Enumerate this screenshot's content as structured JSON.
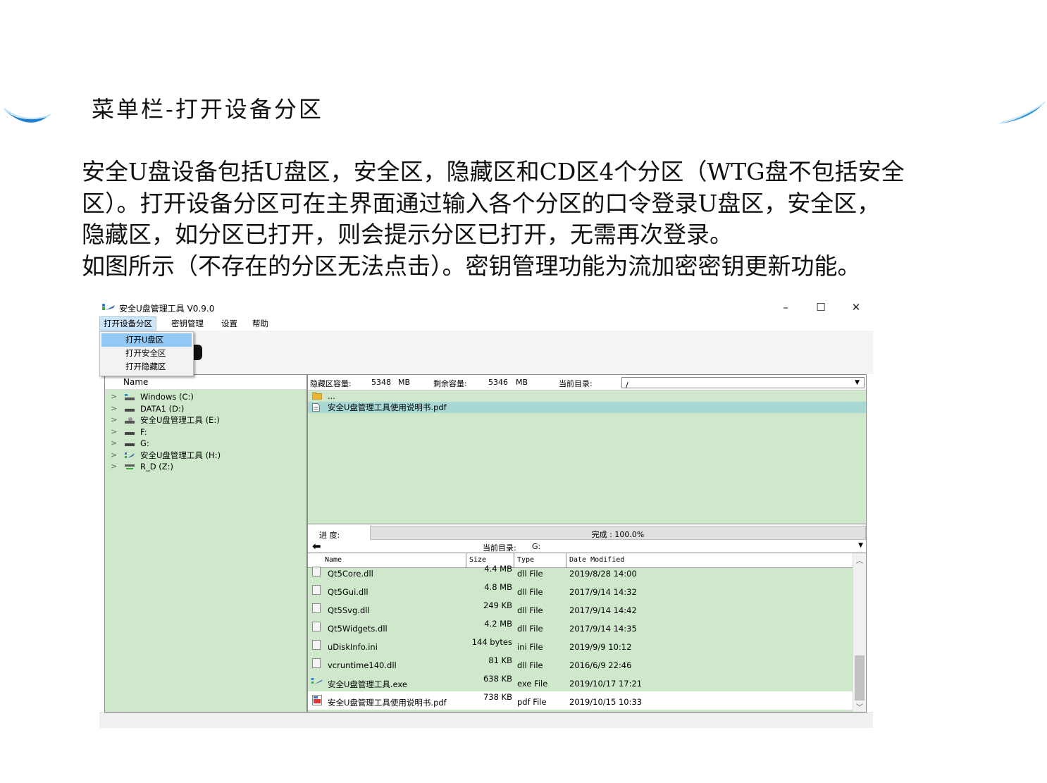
{
  "slide": {
    "title": "菜单栏-打开设备分区",
    "paragraph_lines": [
      "安全U盘设备包括U盘区，安全区，隐藏区和CD区4个分区（WTG盘不包括安全",
      "区）。打开设备分区可在主界面通过输入各个分区的口令登录U盘区，安全区，",
      "隐藏区，如分区已打开，则会提示分区已打开，无需再次登录。",
      "如图所示（不存在的分区无法点击）。密钥管理功能为流加密密钥更新功能。"
    ],
    "accent_color": "#2a8fd6"
  },
  "window": {
    "title": "安全U盘管理工具 V0.9.0",
    "minimize": "–",
    "maximize": "☐",
    "close": "✕"
  },
  "menu": {
    "items": [
      "打开设备分区",
      "密钥管理",
      "设置",
      "帮助"
    ],
    "dropdown": [
      "打开U盘区",
      "打开安全区",
      "打开隐藏区"
    ]
  },
  "tree": {
    "header": "Name",
    "items": [
      {
        "label": "Windows (C:)",
        "icon": "windows-drive-icon"
      },
      {
        "label": "DATA1 (D:)",
        "icon": "drive-icon"
      },
      {
        "label": "安全U盘管理工具 (E:)",
        "icon": "cd-drive-icon"
      },
      {
        "label": "F:",
        "icon": "drive-icon"
      },
      {
        "label": "G:",
        "icon": "drive-icon"
      },
      {
        "label": "安全U盘管理工具 (H:)",
        "icon": "app-drive-icon"
      },
      {
        "label": "R_D (Z:)",
        "icon": "network-drive-icon"
      }
    ]
  },
  "right_panel": {
    "hidden_capacity_label": "隐藏区容量:",
    "hidden_capacity_value": "5348",
    "unit": "MB",
    "free_label": "剩余容量:",
    "free_value": "5346",
    "current_dir_label": "当前目录:",
    "current_dir_value": "/",
    "rows": [
      {
        "label": "...",
        "icon": "folder-icon"
      },
      {
        "label": "安全U盘管理工具使用说明书.pdf",
        "icon": "file-icon"
      }
    ]
  },
  "progress": {
    "label": "进 度:",
    "text": "完成 : 100.0%",
    "fraction": 1.0
  },
  "file_dir": {
    "label": "当前目录:",
    "value": "G:"
  },
  "file_table": {
    "headers": [
      "Name",
      "Size",
      "Type",
      "Date Modified"
    ],
    "rows": [
      {
        "name": "Qt5Core.dll",
        "size": "4.4 MB",
        "type": "dll File",
        "date": "2019/8/28 14:00"
      },
      {
        "name": "Qt5Gui.dll",
        "size": "4.8 MB",
        "type": "dll File",
        "date": "2017/9/14 14:32"
      },
      {
        "name": "Qt5Svg.dll",
        "size": "249 KB",
        "type": "dll File",
        "date": "2017/9/14 14:42"
      },
      {
        "name": "Qt5Widgets.dll",
        "size": "4.2 MB",
        "type": "dll File",
        "date": "2017/9/14 14:35"
      },
      {
        "name": "uDiskInfo.ini",
        "size": "144 bytes",
        "type": "ini File",
        "date": "2019/9/9 10:12"
      },
      {
        "name": "vcruntime140.dll",
        "size": "81 KB",
        "type": "dll File",
        "date": "2016/6/9 22:46"
      },
      {
        "name": "安全U盘管理工具.exe",
        "size": "638 KB",
        "type": "exe File",
        "date": "2019/10/17 17:21"
      },
      {
        "name": "安全U盘管理工具使用说明书.pdf",
        "size": "738 KB",
        "type": "pdf File",
        "date": "2019/10/15 10:33"
      }
    ]
  }
}
